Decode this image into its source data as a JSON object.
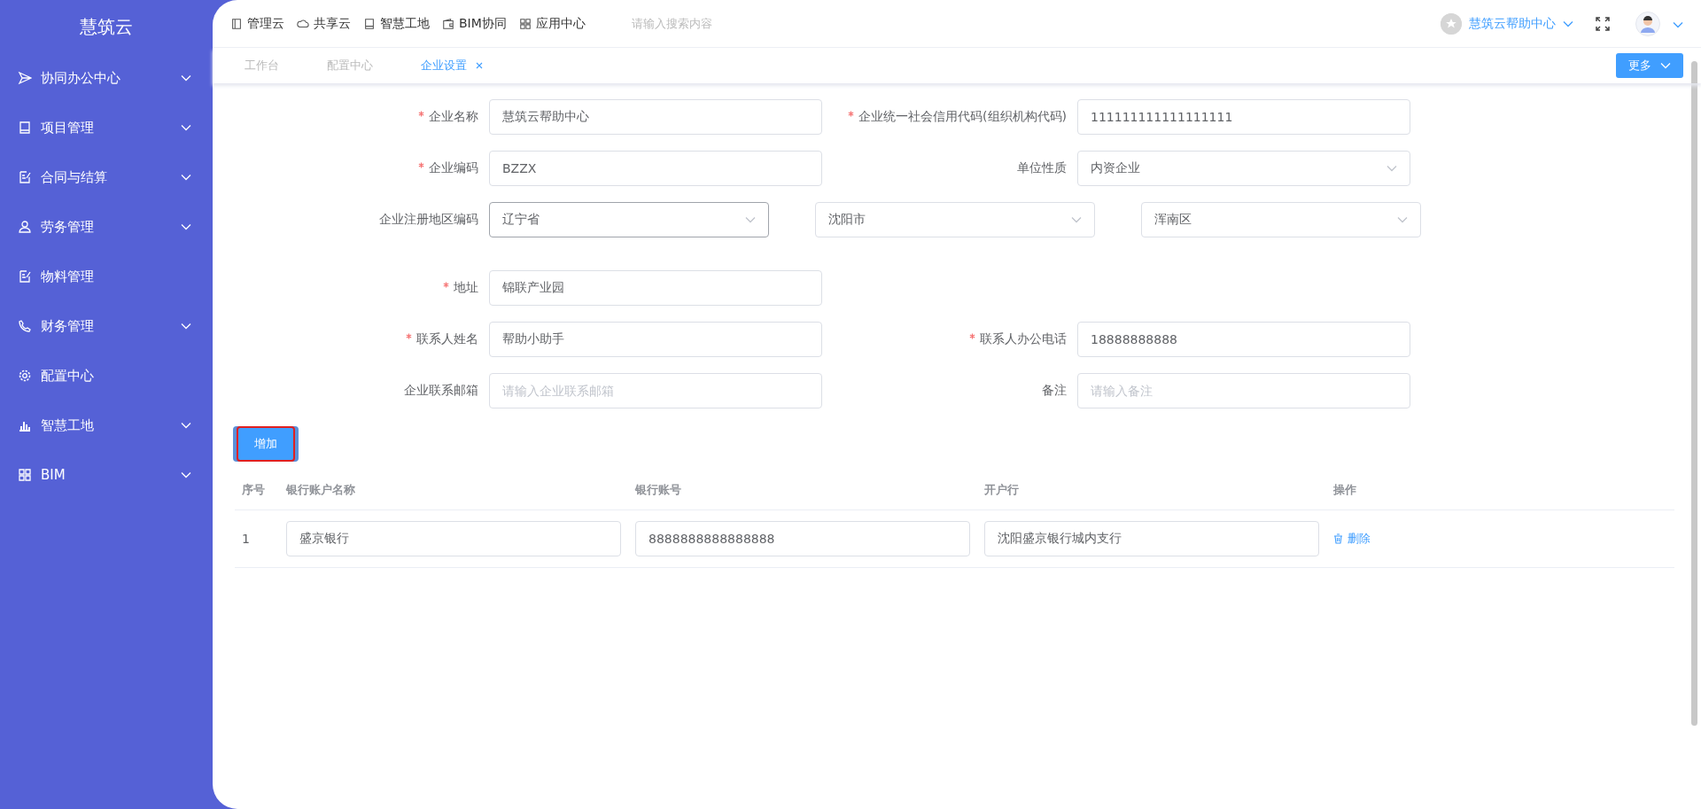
{
  "sidebar": {
    "title": "慧筑云",
    "items": [
      {
        "label": "协同办公中心",
        "expandable": true
      },
      {
        "label": "项目管理",
        "expandable": true
      },
      {
        "label": "合同与结算",
        "expandable": true
      },
      {
        "label": "劳务管理",
        "expandable": true
      },
      {
        "label": "物料管理",
        "expandable": false
      },
      {
        "label": "财务管理",
        "expandable": true
      },
      {
        "label": "配置中心",
        "expandable": false
      },
      {
        "label": "智慧工地",
        "expandable": true
      },
      {
        "label": "BIM",
        "expandable": true
      }
    ]
  },
  "topbar": {
    "nav": [
      "管理云",
      "共享云",
      "智慧工地",
      "BIM协同",
      "应用中心"
    ],
    "search": {
      "placeholder": "请输入搜索内容"
    },
    "org": "慧筑云帮助中心"
  },
  "tabs": [
    {
      "label": "工作台",
      "selected": false,
      "closable": false
    },
    {
      "label": "配置中心",
      "selected": false,
      "closable": false
    },
    {
      "label": "企业设置",
      "selected": true,
      "closable": true
    }
  ],
  "more_button": "更多",
  "form": {
    "rows": [
      {
        "kind": "fields",
        "fields": [
          {
            "label": "企业名称",
            "required": true,
            "kind": "input",
            "value": "慧筑云帮助中心"
          },
          {
            "label": "企业统一社会信用代码(组织机构代码)",
            "required": true,
            "kind": "input",
            "value": "111111111111111111"
          }
        ]
      },
      {
        "kind": "fields",
        "fields": [
          {
            "label": "企业编码",
            "required": true,
            "kind": "input",
            "value": "BZZX"
          },
          {
            "label": "单位性质",
            "required": false,
            "kind": "select",
            "value": "内资企业"
          }
        ]
      },
      {
        "kind": "region",
        "label": "企业注册地区编码",
        "selects": [
          {
            "value": "辽宁省",
            "focused": true
          },
          {
            "value": "沈阳市",
            "focused": false
          },
          {
            "value": "浑南区",
            "focused": false
          }
        ]
      },
      {
        "kind": "fields",
        "fields": [
          {
            "label": "地址",
            "required": true,
            "kind": "input",
            "value": "锦联产业园"
          }
        ]
      },
      {
        "kind": "fields",
        "fields": [
          {
            "label": "联系人姓名",
            "required": true,
            "kind": "input",
            "value": "帮助小助手"
          },
          {
            "label": "联系人办公电话",
            "required": true,
            "kind": "input",
            "value": "18888888888"
          }
        ]
      },
      {
        "kind": "fields",
        "fields": [
          {
            "label": "企业联系邮箱",
            "required": false,
            "kind": "input",
            "placeholder": "请输入企业联系邮箱"
          },
          {
            "label": "备注",
            "required": false,
            "kind": "input",
            "placeholder": "请输入备注"
          }
        ]
      }
    ]
  },
  "bank": {
    "add_button": {
      "label": "增加",
      "highlighted": true
    },
    "columns": [
      "序号",
      "银行账户名称",
      "银行账号",
      "开户行",
      "操作"
    ],
    "rows": [
      {
        "index": "1",
        "name": "盛京银行",
        "account": "8888888888888888",
        "bank": "沈阳盛京银行城内支行",
        "action": "删除"
      }
    ]
  }
}
